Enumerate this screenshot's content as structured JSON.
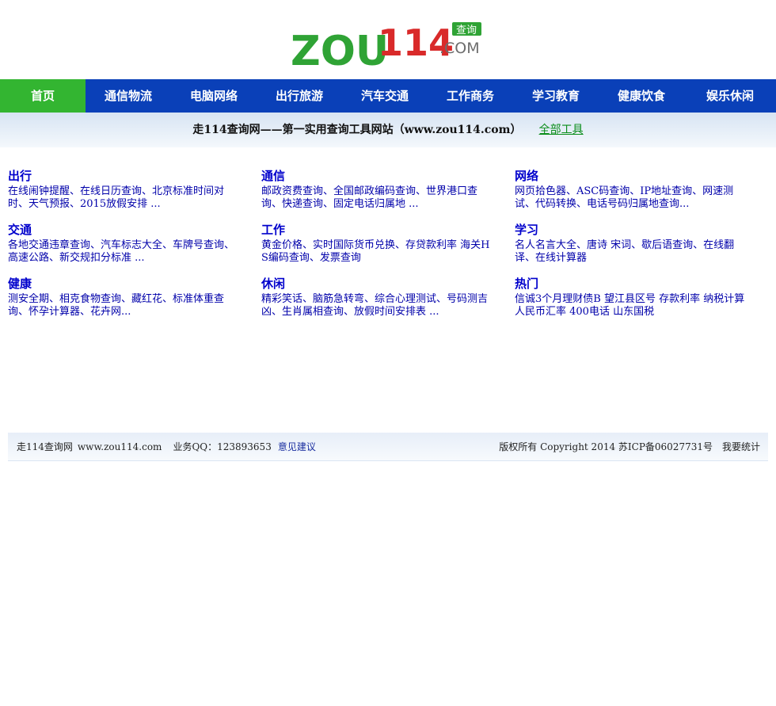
{
  "logo": {
    "text": "ZOU114",
    "badge": "查询",
    "suffix": ".COM",
    "green": "#2fa335",
    "red": "#d92a2a",
    "gray": "#6d6d6d"
  },
  "nav": {
    "items": [
      "首页",
      "通信物流",
      "电脑网络",
      "出行旅游",
      "汽车交通",
      "工作商务",
      "学习教育",
      "健康饮食",
      "娱乐休闲"
    ],
    "active_index": 0,
    "bg_color": "#0a40b8",
    "active_color": "#33b531"
  },
  "banner": {
    "text": "走114查询网——第一实用查询工具网站（www.zou114.com）",
    "link": "全部工具"
  },
  "sections": [
    {
      "title": "出行",
      "body": "在线闹钟提醒、在线日历查询、北京标准时间对时、天气预报、2015放假安排 ..."
    },
    {
      "title": "通信",
      "body": "邮政资费查询、全国邮政编码查询、世界港口查询、快递查询、固定电话归属地 ..."
    },
    {
      "title": "网络",
      "body": "网页拾色器、ASC码查询、IP地址查询、网速测试、代码转换、电话号码归属地查询..."
    },
    {
      "title": "交通",
      "body": "各地交通违章查询、汽车标志大全、车牌号查询、高速公路、新交规扣分标准 ..."
    },
    {
      "title": "工作",
      "body": "黄金价格、实时国际货币兑换、存贷款利率 海关HS编码查询、发票查询"
    },
    {
      "title": "学习",
      "body": "名人名言大全、唐诗 宋词、歇后语查询、在线翻译、在线计算器"
    },
    {
      "title": "健康",
      "body": "测安全期、相克食物查询、藏红花、标准体重查询、怀孕计算器、花卉网..."
    },
    {
      "title": "休闲",
      "body": "精彩笑话、脑筋急转弯、综合心理测试、号码测吉凶、生肖属相查询、放假时间安排表 ..."
    },
    {
      "title": "热门",
      "body": "信诚3个月理财债B 望江县区号 存款利率 纳税计算 人民币汇率 400电话 山东国税"
    }
  ],
  "footer": {
    "site_name": "走114查询网",
    "url": "www.zou114.com",
    "qq": "业务QQ：123893653",
    "feedback": "意见建议",
    "copyright": "版权所有 Copyright 2014 苏ICP备06027731号",
    "stats": "我要统计"
  }
}
